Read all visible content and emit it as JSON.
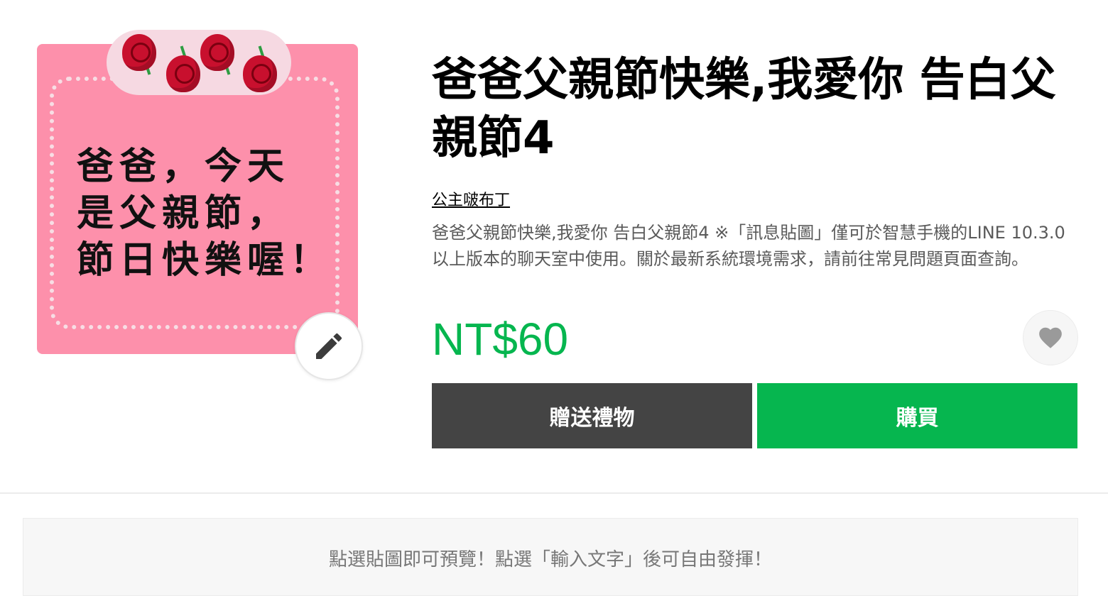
{
  "sticker": {
    "image_text": "爸爸，今天\n是父親節，\n節日快樂喔！",
    "edit_icon": "pencil-icon"
  },
  "product": {
    "title": "爸爸父親節快樂,我愛你 告白父親節4",
    "author": "公主啵布丁",
    "description": "爸爸父親節快樂,我愛你 告白父親節4 ※「訊息貼圖」僅可於智慧手機的LINE 10.3.0以上版本的聊天室中使用。關於最新系統環境需求，請前往常見問題頁面查詢。",
    "price": "NT$60",
    "favorite_icon": "heart-icon"
  },
  "buttons": {
    "gift_label": "贈送禮物",
    "buy_label": "購買"
  },
  "preview": {
    "notice": "點選貼圖即可預覽！點選「輸入文字」後可自由發揮！"
  },
  "colors": {
    "accent_green": "#06b64f",
    "gift_button": "#444444",
    "sticker_pink": "#fd90ab"
  }
}
